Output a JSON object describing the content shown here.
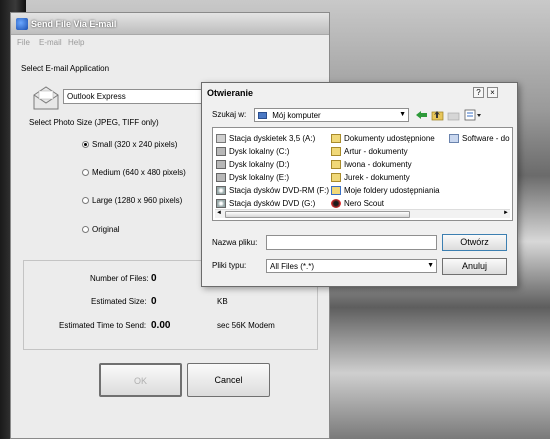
{
  "main_window": {
    "title": "Send File Via E-mail",
    "menu": [
      "File",
      "E-mail",
      "Help"
    ],
    "select_app_label": "Select E-mail Application",
    "email_app": "Outlook Express",
    "photo_size_label": "Select Photo Size (JPEG, TIFF only)",
    "sizes": [
      {
        "label": "Small (320 x 240 pixels)",
        "selected": true
      },
      {
        "label": "Medium (640 x 480 pixels)",
        "selected": false
      },
      {
        "label": "Large (1280 x 960 pixels)",
        "selected": false
      },
      {
        "label": "Original",
        "selected": false
      }
    ],
    "num_files_label": "Number of Files:",
    "num_files_value": "0",
    "est_size_label": "Estimated Size:",
    "est_size_value": "0",
    "est_size_unit": "KB",
    "est_time_label": "Estimated Time to Send:",
    "est_time_value": "0.00",
    "est_time_unit": "sec 56K Modem",
    "ok_label": "OK",
    "cancel_label": "Cancel"
  },
  "open_dialog": {
    "title": "Otwieranie",
    "help": "?",
    "close": "×",
    "look_in_label": "Szukaj w:",
    "look_in_value": "Mój komputer",
    "items": [
      {
        "label": "Stacja dyskietek 3,5 (A:)",
        "icon": "floppy-icon"
      },
      {
        "label": "Dysk lokalny (C:)",
        "icon": "drive-icon"
      },
      {
        "label": "Dysk lokalny (D:)",
        "icon": "drive-icon"
      },
      {
        "label": "Dysk lokalny (E:)",
        "icon": "drive-icon"
      },
      {
        "label": "Stacja dysków DVD-RM (F:)",
        "icon": "dvd-icon"
      },
      {
        "label": "Stacja dysków DVD (G:)",
        "icon": "dvd-icon"
      },
      {
        "label": "Dokumenty udostępnione",
        "icon": "folder-icon"
      },
      {
        "label": "Artur - dokumenty",
        "icon": "folder-icon"
      },
      {
        "label": "Iwona - dokumenty",
        "icon": "folder-icon"
      },
      {
        "label": "Jurek - dokumenty",
        "icon": "folder-icon"
      },
      {
        "label": "Moje foldery udostępniania",
        "icon": "shared-folder-icon"
      },
      {
        "label": "Nero Scout",
        "icon": "nero-icon"
      },
      {
        "label": "Software - do",
        "icon": "folder-icon"
      }
    ],
    "filename_label": "Nazwa pliku:",
    "filename_value": "",
    "filetype_label": "Pliki typu:",
    "filetype_value": "All Files (*.*)",
    "open_label": "Otwórz",
    "cancel_label": "Anuluj"
  }
}
